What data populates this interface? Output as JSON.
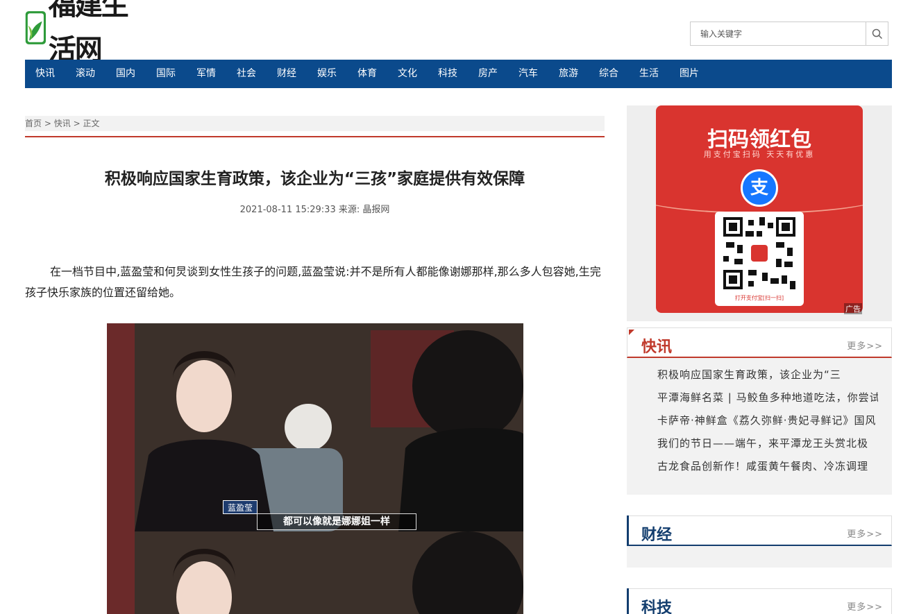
{
  "header": {
    "logo_text": "福建生活网",
    "search_placeholder": "输入关键字"
  },
  "nav": [
    "快讯",
    "滚动",
    "国内",
    "国际",
    "军情",
    "社会",
    "财经",
    "娱乐",
    "体育",
    "文化",
    "科技",
    "房产",
    "汽车",
    "旅游",
    "综合",
    "生活",
    "图片"
  ],
  "breadcrumb": {
    "home": "首页",
    "section": "快讯",
    "current": "正文",
    "sep": ">"
  },
  "article": {
    "title": "积极响应国家生育政策，该企业为“三孩”家庭提供有效保障",
    "meta": "2021-08-11 15:29:33 来源: 晶报网",
    "paragraph": "在一档节目中,蓝盈莹和何炅谈到女性生孩子的问题,蓝盈莹说:并不是所有人都能像谢娜那样,那么多人包容她,生完孩子快乐家族的位置还留给她。",
    "photo_name_tag": "蓝盈莹",
    "photo_caption": "都可以像就是娜娜姐一样"
  },
  "ad": {
    "title": "扫码领红包",
    "subtitle": "用支付宝扫码 天天有优惠",
    "logo_char": "支",
    "qr_label": "打开支付宝[扫一扫]",
    "badge": "广告"
  },
  "sidebar": {
    "more_label": "更多>>",
    "kuaixun": {
      "title": "快讯",
      "title_color": "#c0392b",
      "items": [
        "积极响应国家生育政策，该企业为“三",
        "平潭海鲜名菜 | 马鲛鱼多种地道吃法，你尝试",
        "卡萨帝·神鲜盒《荔久弥鲜·贵妃寻鲜记》国风",
        "我们的节日——端午，来平潭龙王头赏北极",
        "古龙食品创新作！咸蛋黄午餐肉、冷冻调理"
      ]
    },
    "caijing": {
      "title": "财经",
      "title_color": "#123d6e"
    },
    "keji": {
      "title": "科技",
      "title_color": "#123d6e"
    }
  },
  "colors": {
    "nav_bg": "#0b4a8c",
    "accent_red": "#c0392b",
    "ad_red": "#d9342f",
    "alipay_blue": "#1677ff"
  }
}
